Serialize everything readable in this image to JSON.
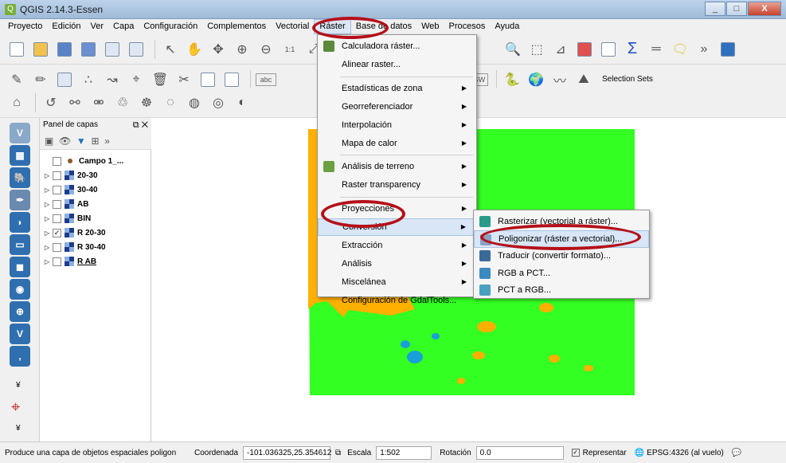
{
  "window": {
    "title": "QGIS 2.14.3-Essen",
    "min": "_",
    "max": "□",
    "close": "X"
  },
  "menubar": [
    "Proyecto",
    "Edición",
    "Ver",
    "Capa",
    "Configuración",
    "Complementos",
    "Vectorial",
    "Ráster",
    "Base de datos",
    "Web",
    "Procesos",
    "Ayuda"
  ],
  "toolbar": {
    "selection_sets": "Selection Sets",
    "abc": "abc",
    "sw": "SW",
    "scale_icon": "1:1"
  },
  "layers_panel": {
    "title": "Panel de capas",
    "layers": [
      {
        "name": "Campo 1_...",
        "checked": false,
        "type": "point"
      },
      {
        "name": "20-30",
        "checked": false,
        "type": "raster"
      },
      {
        "name": "30-40",
        "checked": false,
        "type": "raster"
      },
      {
        "name": "AB",
        "checked": false,
        "type": "raster"
      },
      {
        "name": "BIN",
        "checked": false,
        "type": "raster"
      },
      {
        "name": "R 20-30",
        "checked": true,
        "type": "raster"
      },
      {
        "name": "R 30-40",
        "checked": false,
        "type": "raster"
      },
      {
        "name": "R AB",
        "checked": false,
        "type": "raster",
        "selected": true
      }
    ]
  },
  "raster_menu": [
    {
      "label": "Calculadora ráster...",
      "icon": "calculator-icon"
    },
    {
      "label": "Alinear raster..."
    },
    {
      "separator": true
    },
    {
      "label": "Estadísticas de zona",
      "submenu": true
    },
    {
      "label": "Georreferenciador",
      "submenu": true
    },
    {
      "label": "Interpolación",
      "submenu": true
    },
    {
      "label": "Mapa de calor",
      "submenu": true
    },
    {
      "separator": true
    },
    {
      "label": "Análisis de terreno",
      "submenu": true,
      "icon": "terrain-icon"
    },
    {
      "label": "Raster transparency",
      "submenu": true
    },
    {
      "separator": true
    },
    {
      "label": "Proyecciones",
      "submenu": true
    },
    {
      "label": "Conversión",
      "submenu": true,
      "highlighted": true
    },
    {
      "label": "Extracción",
      "submenu": true
    },
    {
      "label": "Análisis",
      "submenu": true
    },
    {
      "label": "Miscelánea",
      "submenu": true
    },
    {
      "label": "Configuración de GdalTools..."
    }
  ],
  "conversion_submenu": [
    {
      "label": "Rasterizar (vectorial a ráster)...",
      "icon": "rasterize-icon"
    },
    {
      "label": "Poligonizar (ráster a vectorial)...",
      "icon": "polygonize-icon",
      "highlighted": true
    },
    {
      "label": "Traducir (convertir formato)...",
      "icon": "translate-icon"
    },
    {
      "label": "RGB a PCT...",
      "icon": "rgb-to-pct-icon"
    },
    {
      "label": "PCT a RGB...",
      "icon": "pct-to-rgb-icon"
    }
  ],
  "statusbar": {
    "message": "Produce una capa de objetos espaciales poligon",
    "coord_label": "Coordenada",
    "coord_value": "-101.036325,25.354612",
    "scale_label": "Escala",
    "scale_value": "1:502",
    "rotation_label": "Rotación",
    "rotation_value": "0.0",
    "render_label": "Representar",
    "crs": "EPSG:4326 (al vuelo)"
  },
  "colors": {
    "green": "#33ff22",
    "orange": "#ffb000",
    "blue": "#1aa0d8",
    "annotation": "#b4101a"
  }
}
